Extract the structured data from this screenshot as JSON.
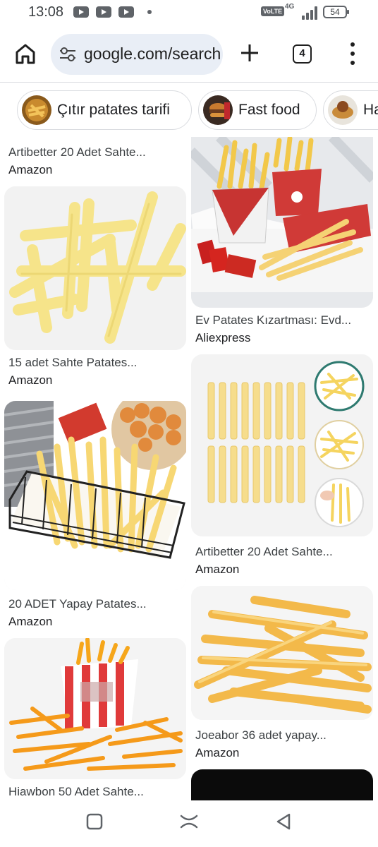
{
  "status_bar": {
    "time": "13:08",
    "network": "4G",
    "volte": "VoLTE",
    "battery": "54"
  },
  "toolbar": {
    "url": "google.com/search",
    "tab_count": "4"
  },
  "chips": [
    {
      "label": "Çıtır patates tarifi"
    },
    {
      "label": "Fast food"
    },
    {
      "label": "Ha"
    }
  ],
  "results": {
    "left": [
      {
        "title": "Artibetter 20 Adet Sahte...",
        "source": "Amazon"
      },
      {
        "title": "15 adet Sahte Patates...",
        "source": "Amazon"
      },
      {
        "title": "20 ADET Yapay Patates...",
        "source": "Amazon"
      },
      {
        "title": "Hiawbon 50 Adet Sahte...",
        "source": ""
      }
    ],
    "right": [
      {
        "title": "Ev Patates Kızartması: Evd...",
        "source": "Aliexpress"
      },
      {
        "title": "Artibetter 20 Adet Sahte...",
        "source": "Amazon"
      },
      {
        "title": "Joeabor 36 adet yapay...",
        "source": "Amazon"
      }
    ]
  },
  "icons": [
    "home-icon",
    "tune-icon",
    "plus-icon",
    "tabs-icon",
    "more-vert-icon",
    "recents-icon",
    "home-gesture-icon",
    "back-icon"
  ],
  "colors": {
    "url_bar": "#e9eef6",
    "fries": "#f7d26a",
    "box_red": "#d63b3b"
  }
}
